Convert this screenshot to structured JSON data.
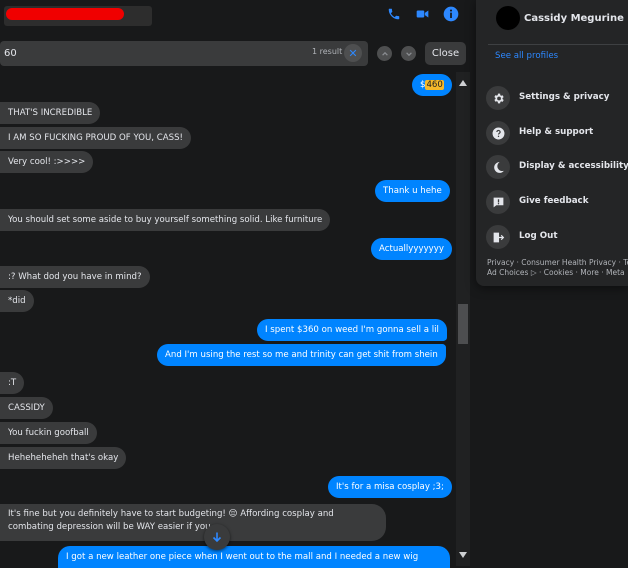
{
  "search": {
    "value": "60",
    "result_count": "1 result",
    "close_label": "Close"
  },
  "messages": [
    {
      "dir": "out",
      "pre": "$",
      "highlight": "460",
      "text": ""
    },
    {
      "dir": "in",
      "text": "THAT'S INCREDIBLE"
    },
    {
      "dir": "in",
      "text": "I AM SO FUCKING PROUD OF YOU, CASS!"
    },
    {
      "dir": "in",
      "text": "Very cool! :>>>>"
    },
    {
      "dir": "out",
      "text": "Thank u hehe"
    },
    {
      "dir": "in",
      "text": "You should set some aside to buy yourself something solid. Like furniture"
    },
    {
      "dir": "out",
      "text": "Actuallyyyyyyy"
    },
    {
      "dir": "in",
      "text": ":? What dod you have in mind?"
    },
    {
      "dir": "in",
      "text": "*did"
    },
    {
      "dir": "out",
      "text": "I spent $360 on weed I'm gonna sell a lil"
    },
    {
      "dir": "out",
      "text": "And I'm using the rest so me and trinity can get shit from shein"
    },
    {
      "dir": "in",
      "text": ":T"
    },
    {
      "dir": "in",
      "text": "CASSIDY"
    },
    {
      "dir": "in",
      "text": "You fuckin goofball"
    },
    {
      "dir": "in",
      "text": "Heheheheheh that's okay"
    },
    {
      "dir": "out",
      "text": "It's for a misa cosplay ;3;"
    },
    {
      "dir": "in",
      "text": "It's fine but you definitely have to start budgeting! 😔 Affording cosplay and combating depression will be WAY easier if you"
    },
    {
      "dir": "out",
      "text": "I got a new leather one piece when I went out to the mall and I needed a new wig"
    }
  ],
  "profile": {
    "name": "Cassidy Megurine",
    "see_all": "See all profiles"
  },
  "menu": [
    {
      "label": "Settings & privacy",
      "icon": "gear-icon"
    },
    {
      "label": "Help & support",
      "icon": "question-icon"
    },
    {
      "label": "Display & accessibility",
      "icon": "moon-icon"
    },
    {
      "label": "Give feedback",
      "icon": "feedback-icon"
    },
    {
      "label": "Log Out",
      "icon": "logout-icon"
    }
  ],
  "footer": {
    "line1": "Privacy · Consumer Health Privacy · Te",
    "line2": "Ad Choices ▷ · Cookies · More · Meta"
  },
  "colors": {
    "accent": "#0084ff",
    "link": "#2d88ff",
    "highlight": "#f5b92a",
    "redaction": "#f00000"
  }
}
